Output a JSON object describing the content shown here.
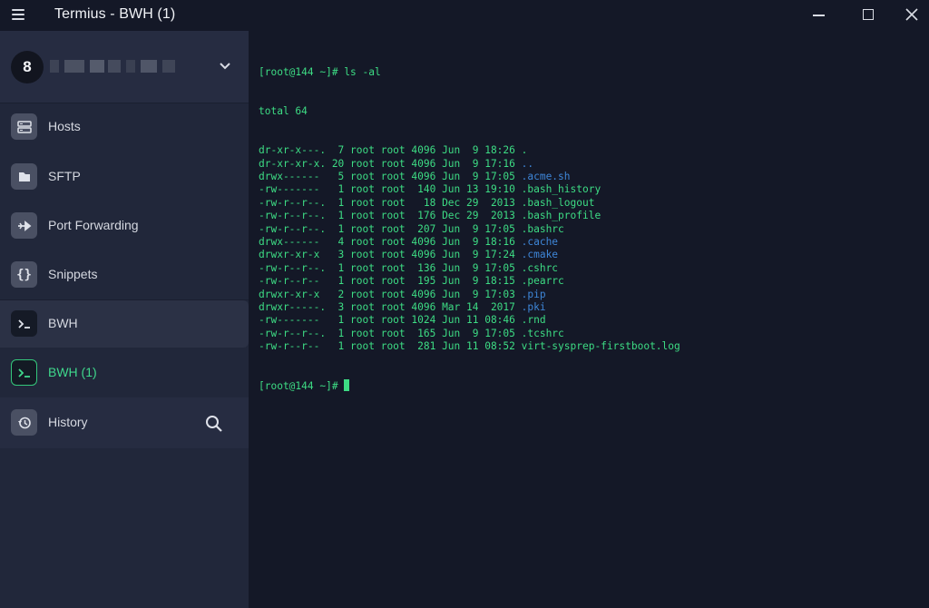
{
  "window": {
    "title": "Termius - BWH (1)"
  },
  "account": {
    "badge": "8",
    "name_redacted": true
  },
  "sidebar": {
    "items": [
      {
        "label": "Hosts",
        "icon": "hosts-icon"
      },
      {
        "label": "SFTP",
        "icon": "folder-icon"
      },
      {
        "label": "Port Forwarding",
        "icon": "port-forwarding-icon"
      },
      {
        "label": "Snippets",
        "icon": "snippets-icon"
      },
      {
        "label": "BWH",
        "icon": "terminal-icon"
      },
      {
        "label": "BWH (1)",
        "icon": "terminal-icon",
        "active": true
      },
      {
        "label": "History",
        "icon": "history-icon"
      }
    ]
  },
  "terminal": {
    "prompt": "[root@144 ~]# ",
    "command": "ls -al",
    "total": "total 64",
    "entries": [
      {
        "meta": "dr-xr-x---.  7 root root 4096 Jun  9 18:26 ",
        "name": ".",
        "type": "file"
      },
      {
        "meta": "dr-xr-xr-x. 20 root root 4096 Jun  9 17:16 ",
        "name": "..",
        "type": "dir"
      },
      {
        "meta": "drwx------   5 root root 4096 Jun  9 17:05 ",
        "name": ".acme.sh",
        "type": "dir"
      },
      {
        "meta": "-rw-------   1 root root  140 Jun 13 19:10 ",
        "name": ".bash_history",
        "type": "file"
      },
      {
        "meta": "-rw-r--r--.  1 root root   18 Dec 29  2013 ",
        "name": ".bash_logout",
        "type": "file"
      },
      {
        "meta": "-rw-r--r--.  1 root root  176 Dec 29  2013 ",
        "name": ".bash_profile",
        "type": "file"
      },
      {
        "meta": "-rw-r--r--.  1 root root  207 Jun  9 17:05 ",
        "name": ".bashrc",
        "type": "file"
      },
      {
        "meta": "drwx------   4 root root 4096 Jun  9 18:16 ",
        "name": ".cache",
        "type": "dir"
      },
      {
        "meta": "drwxr-xr-x   3 root root 4096 Jun  9 17:24 ",
        "name": ".cmake",
        "type": "dir"
      },
      {
        "meta": "-rw-r--r--.  1 root root  136 Jun  9 17:05 ",
        "name": ".cshrc",
        "type": "file"
      },
      {
        "meta": "-rw-r--r--   1 root root  195 Jun  9 18:15 ",
        "name": ".pearrc",
        "type": "file"
      },
      {
        "meta": "drwxr-xr-x   2 root root 4096 Jun  9 17:03 ",
        "name": ".pip",
        "type": "dir"
      },
      {
        "meta": "drwxr-----.  3 root root 4096 Mar 14  2017 ",
        "name": ".pki",
        "type": "dir"
      },
      {
        "meta": "-rw-------   1 root root 1024 Jun 11 08:46 ",
        "name": ".rnd",
        "type": "file"
      },
      {
        "meta": "-rw-r--r--.  1 root root  165 Jun  9 17:05 ",
        "name": ".tcshrc",
        "type": "file"
      },
      {
        "meta": "-rw-r--r--   1 root root  281 Jun 11 08:52 ",
        "name": "virt-sysprep-firstboot.log",
        "type": "file"
      }
    ],
    "colors": {
      "text": "#3ddc84",
      "directory": "#3e86d8",
      "background": "#141827"
    }
  }
}
